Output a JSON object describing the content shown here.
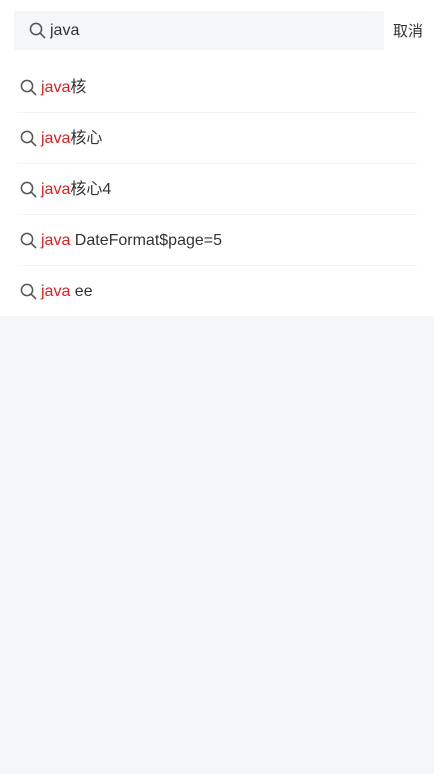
{
  "search": {
    "icon": "search-icon",
    "value": "java",
    "cancel_label": "取消"
  },
  "suggestions": [
    {
      "icon": "search-icon",
      "keyword": "java",
      "rest": "核"
    },
    {
      "icon": "search-icon",
      "keyword": "java",
      "rest": "核心"
    },
    {
      "icon": "search-icon",
      "keyword": "java",
      "rest": "核心4"
    },
    {
      "icon": "search-icon",
      "keyword": "java",
      "rest": " DateFormat$page=5"
    },
    {
      "icon": "search-icon",
      "keyword": "java",
      "rest": " ee"
    }
  ],
  "colors": {
    "keyword_highlight": "#e02020",
    "page_background": "#f5f6f8",
    "panel_background": "#ffffff"
  }
}
